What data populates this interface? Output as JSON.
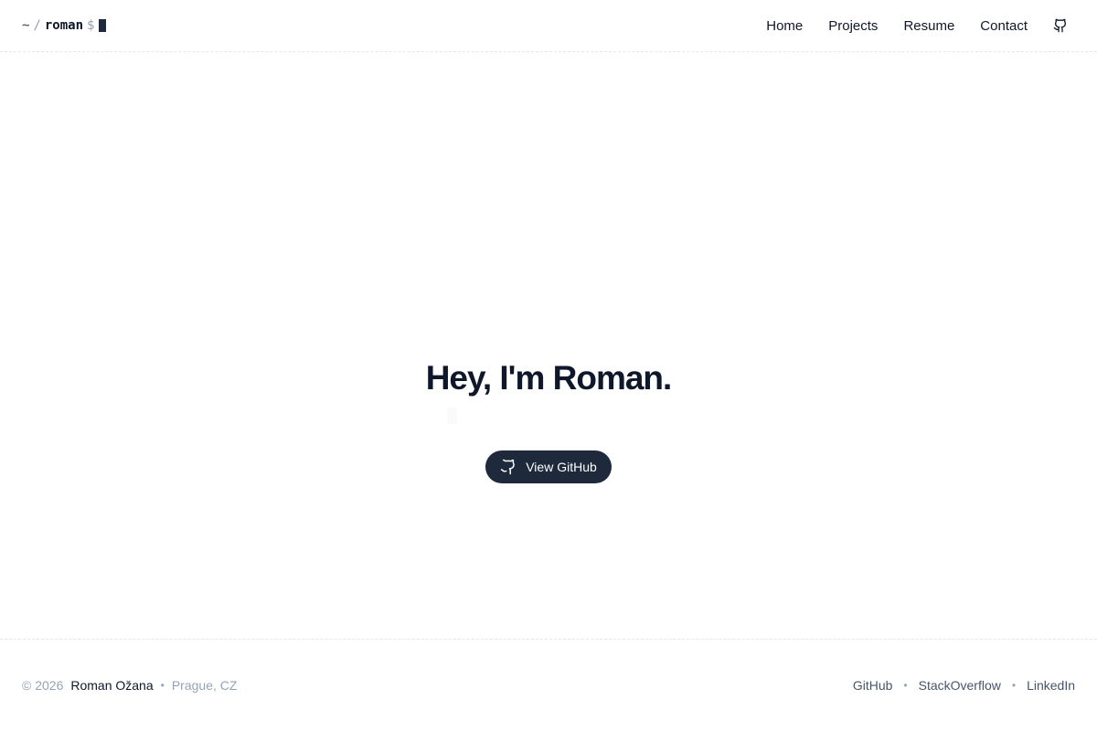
{
  "header": {
    "brand": {
      "tilde": "~",
      "slash": "/",
      "name": "roman",
      "prompt": "$"
    },
    "nav": [
      {
        "label": "Home"
      },
      {
        "label": "Projects"
      },
      {
        "label": "Resume"
      },
      {
        "label": "Contact"
      }
    ],
    "github_icon": "github-icon"
  },
  "hero": {
    "title": "Hey, I'm Roman.",
    "cta_label": "View GitHub",
    "cta_icon": "github-icon"
  },
  "footer": {
    "copyright": "© 2026",
    "owner": "Roman Ožana",
    "separator": "•",
    "location": "Prague, CZ",
    "links": [
      {
        "label": "GitHub"
      },
      {
        "label": "StackOverflow"
      },
      {
        "label": "LinkedIn"
      }
    ]
  },
  "colors": {
    "text": "#0f172a",
    "muted": "#94a3b8",
    "button_bg": "#1e293b",
    "border": "#e5e7eb"
  }
}
